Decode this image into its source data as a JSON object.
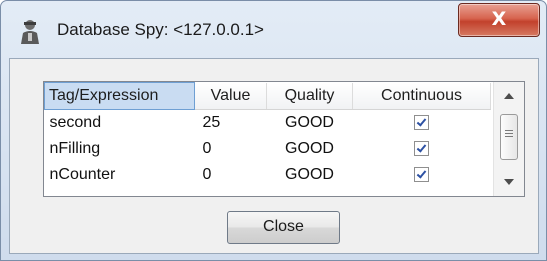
{
  "window": {
    "title": "Database Spy: <127.0.0.1>",
    "close_glyph": "X",
    "app_icon": "user-icon"
  },
  "table": {
    "columns": [
      "Tag/Expression",
      "Value",
      "Quality",
      "Continuous"
    ],
    "rows": [
      {
        "tag": "second",
        "value": "25",
        "quality": "GOOD",
        "continuous": true
      },
      {
        "tag": "nFilling",
        "value": "0",
        "quality": "GOOD",
        "continuous": true
      },
      {
        "tag": "nCounter",
        "value": "0",
        "quality": "GOOD",
        "continuous": true
      }
    ]
  },
  "buttons": {
    "close_label": "Close"
  },
  "colors": {
    "title_bar": "#dbe6f3",
    "close_button": "#c9412c",
    "selected_header": "#c9dcf2",
    "check": "#2d51a3"
  }
}
